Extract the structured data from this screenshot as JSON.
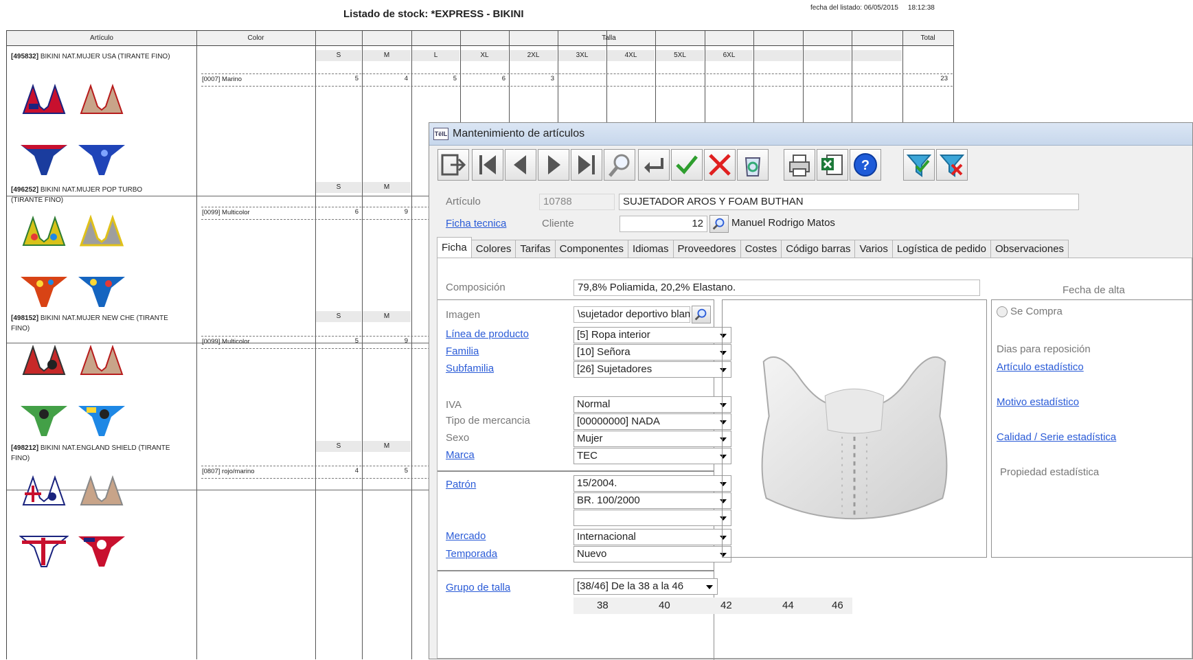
{
  "report": {
    "title": "Listado de stock: *EXPRESS - BIKINI",
    "date_label": "fecha del listado: 06/05/2015",
    "time": "18:12:38",
    "headers": {
      "articulo": "Artículo",
      "color": "Color",
      "talla": "Talla",
      "total": "Total"
    },
    "sizes": [
      "S",
      "M",
      "L",
      "XL",
      "2XL",
      "3XL",
      "4XL",
      "5XL",
      "6XL"
    ],
    "rows": [
      {
        "code": "[495832]",
        "name": "BIKINI NAT.MUJER USA (TIRANTE FINO)",
        "color": "[0007] Marino",
        "qty": [
          "5",
          "4",
          "5",
          "6",
          "3"
        ],
        "total": "23"
      },
      {
        "code": "[496252]",
        "name": "BIKINI NAT.MUJER POP TURBO (TIRANTE FINO)",
        "color": "[0099] Multicolor",
        "qty": [
          "6",
          "9"
        ],
        "total": ""
      },
      {
        "code": "[498152]",
        "name": "BIKINI NAT.MUJER NEW CHE (TIRANTE FINO)",
        "color": "[0099] Multicolor",
        "qty": [
          "5",
          "9"
        ],
        "total": ""
      },
      {
        "code": "[498212]",
        "name": "BIKINI  NAT.ENGLAND SHIELD (TIRANTE FINO)",
        "color": "[0807] rojo/marino",
        "qty": [
          "4",
          "5"
        ],
        "total": ""
      }
    ]
  },
  "window": {
    "title": "Mantenimiento de artículos",
    "app_icon": "TëIL",
    "toolbar": [
      "exit-icon",
      "first-record-icon",
      "prev-record-icon",
      "next-record-icon",
      "last-record-icon",
      "search-icon",
      "return-icon",
      "accept-icon",
      "cancel-icon",
      "recycle-icon",
      "print-icon",
      "excel-icon",
      "help-icon",
      "filter-icon",
      "clear-filter-icon"
    ],
    "articulo_label": "Artículo",
    "articulo_id": "10788",
    "articulo_desc": "SUJETADOR AROS Y FOAM BUTHAN",
    "ficha_tecnica": "Ficha tecnica",
    "cliente_label": "Cliente",
    "cliente_id": "12",
    "cliente_name": "Manuel Rodrigo Matos",
    "tabs": [
      "Ficha",
      "Colores",
      "Tarifas",
      "Componentes",
      "Idiomas",
      "Proveedores",
      "Costes",
      "Código barras",
      "Varios",
      "Logística de pedido",
      "Observaciones"
    ],
    "composicion_label": "Composición",
    "composicion": "79,8% Poliamida, 20,2% Elastano.",
    "fecha_alta_label": "Fecha de alta",
    "imagen_label": "Imagen",
    "imagen_value": "\\sujetador deportivo blanco",
    "linea_label": "Línea de producto",
    "linea": "[5] Ropa interior",
    "familia_label": "Familia",
    "familia": "[10] Señora",
    "subfamilia_label": "Subfamilia",
    "subfamilia": "[26] Sujetadores",
    "iva_label": "IVA",
    "iva": "Normal",
    "tipo_label": "Tipo de mercancia",
    "tipo": "[00000000] NADA",
    "sexo_label": "Sexo",
    "sexo": "Mujer",
    "marca_label": "Marca",
    "marca": "TEC",
    "patron_label": "Patrón",
    "patron1": "15/2004.",
    "patron2": "BR. 100/2000",
    "patron3": "",
    "mercado_label": "Mercado",
    "mercado": "Internacional",
    "temporada_label": "Temporada",
    "temporada": "Nuevo",
    "grupo_label": "Grupo de talla",
    "grupo": "[38/46] De la 38 a la 46",
    "tallas": [
      "38",
      "40",
      "42",
      "44",
      "46"
    ],
    "se_compra": "Se Compra",
    "dias_label": "Dias para reposición",
    "articulo_est": "Artículo estadístico",
    "motivo_est": "Motivo estadístico",
    "calidad_est": "Calidad / Serie estadística",
    "propiedad_est": "Propiedad estadística"
  }
}
